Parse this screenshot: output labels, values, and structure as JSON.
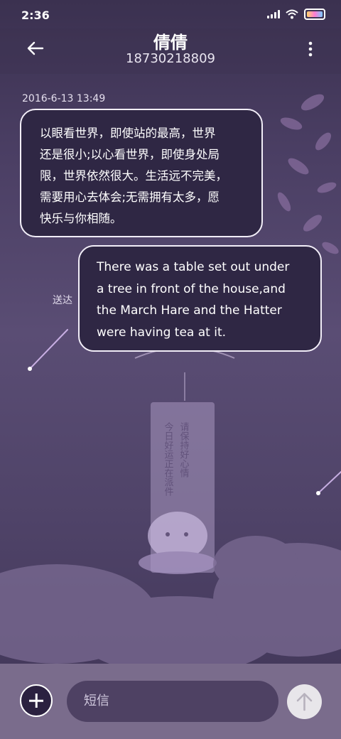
{
  "status_bar": {
    "time": "2:36",
    "icons": [
      "signal-icon",
      "wifi-icon",
      "battery-icon"
    ]
  },
  "header": {
    "contact_name": "倩倩",
    "phone_number": "18730218809",
    "back_icon": "arrow-left-icon",
    "menu_icon": "more-vert-icon"
  },
  "conversation": {
    "timestamp": "2016-6-13 13:49",
    "messages": [
      {
        "direction": "incoming",
        "lines": [
          "以眼看世界，即使站的最高，世界",
          "还是很小;以心看世界，即使身处局",
          "限，世界依然很大。生活远不完美，",
          "需要用心去体会;无需拥有太多，愿",
          "快乐与你相随。"
        ]
      },
      {
        "direction": "outgoing",
        "status": "送达",
        "lines": [
          "There was a table set out under",
          "a tree in front of the house,and",
          "the March Hare and the Hatter",
          "were having tea at it."
        ]
      }
    ]
  },
  "composer": {
    "placeholder": "短信",
    "add_icon": "plus-icon",
    "send_icon": "arrow-up-icon"
  },
  "background": {
    "wind_chime_text_left": "今日好运正在派件",
    "wind_chime_text_right": "请保持好心情"
  },
  "colors": {
    "bubble_fill": "#2f2744",
    "bubble_border": "#f2eef8",
    "composer_bar": "#7a6c8c"
  }
}
